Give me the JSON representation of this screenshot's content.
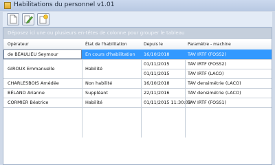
{
  "window": {
    "title": "Habilitations du personnel v1.01"
  },
  "toolbar": {
    "buttons": [
      {
        "icon": "blank-page-icon"
      },
      {
        "icon": "edit-pencil-icon"
      },
      {
        "icon": "add-page-icon"
      }
    ]
  },
  "group_panel": {
    "hint": "Déposez ici une ou plusieurs en-têtes de colonne pour grouper le tableau"
  },
  "table": {
    "columns": [
      "Opérateur",
      "État de l'habilitation",
      "Depuis le",
      "Paramètre - machine"
    ],
    "rows": [
      {
        "operator": "de BEAULIEU Seymour",
        "state": "En cours d'habilitation",
        "since": [
          "16/10/2018"
        ],
        "machine": [
          "TAV IRTF (FOSS2)"
        ],
        "selected": true
      },
      {
        "operator": "GIROUX Emmanuelle",
        "state": "Habilité",
        "since": [
          "01/11/2015",
          "01/11/2015"
        ],
        "machine": [
          "TAV IRTF (FOSS2)",
          "TAV IRTF (LACO)"
        ],
        "selected": false
      },
      {
        "operator": "CHARLESBOIS Amédée",
        "state": "Non habilité",
        "since": [
          "16/10/2018"
        ],
        "machine": [
          "TAV densimétrie (LACO)"
        ],
        "selected": false
      },
      {
        "operator": "BÉLAND Arianne",
        "state": "Suppléant",
        "since": [
          "22/11/2016"
        ],
        "machine": [
          "TAV densimétrie (LACO)"
        ],
        "selected": false
      },
      {
        "operator": "CORMIER Béatrice",
        "state": "Habilité",
        "since": [
          "01/11/2015 11:30:02"
        ],
        "machine": [
          "TAV IRTF (FOSS1)"
        ],
        "selected": false
      }
    ]
  },
  "colors": {
    "selection": "#3399ff",
    "background": "#cfd9e8"
  }
}
